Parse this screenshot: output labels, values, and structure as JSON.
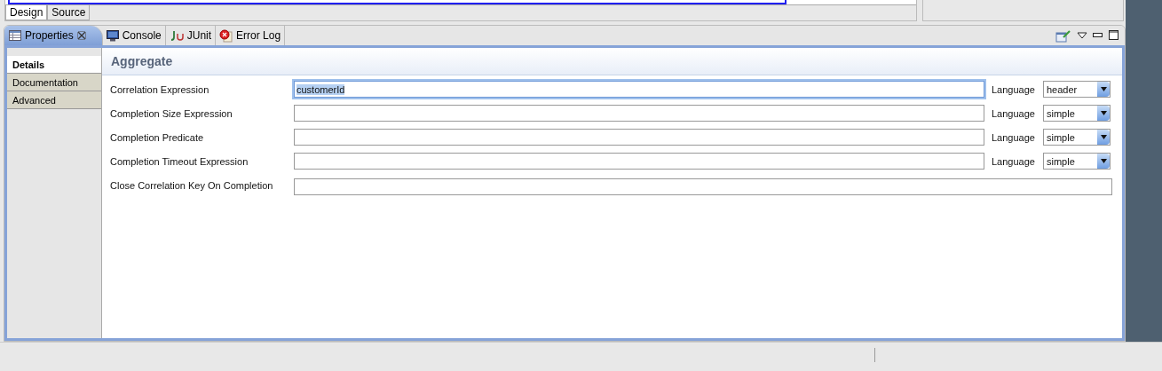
{
  "editor_tabs": [
    {
      "label": "Design",
      "selected": true
    },
    {
      "label": "Source",
      "selected": false
    }
  ],
  "view_tabs": [
    {
      "label": "Properties",
      "kind": "table",
      "selected": true,
      "closable": true
    },
    {
      "label": "Console",
      "kind": "monitor",
      "selected": false,
      "closable": false
    },
    {
      "label": "JUnit",
      "kind": "junit",
      "selected": false,
      "closable": false
    },
    {
      "label": "Error Log",
      "kind": "errorlog",
      "selected": false,
      "closable": false
    }
  ],
  "side_tabs": [
    {
      "label": "Details",
      "selected": true
    },
    {
      "label": "Documentation",
      "selected": false
    },
    {
      "label": "Advanced",
      "selected": false
    }
  ],
  "section_title": "Aggregate",
  "fields": [
    {
      "kind": "expression",
      "label": "Correlation Expression",
      "value": "customerId",
      "focused": true,
      "language_label": "Language",
      "language": "header"
    },
    {
      "kind": "expression",
      "label": "Completion Size Expression",
      "focused": false,
      "language_label": "Language",
      "language": "simple"
    },
    {
      "kind": "expression",
      "label": "Completion Predicate",
      "focused": false,
      "language_label": "Language",
      "language": "simple"
    },
    {
      "kind": "expression",
      "label": "Completion Timeout Expression",
      "focused": false,
      "language_label": "Language",
      "language": "simple"
    },
    {
      "kind": "text",
      "label": "Close Correlation Key On Completion",
      "focused": false
    }
  ]
}
